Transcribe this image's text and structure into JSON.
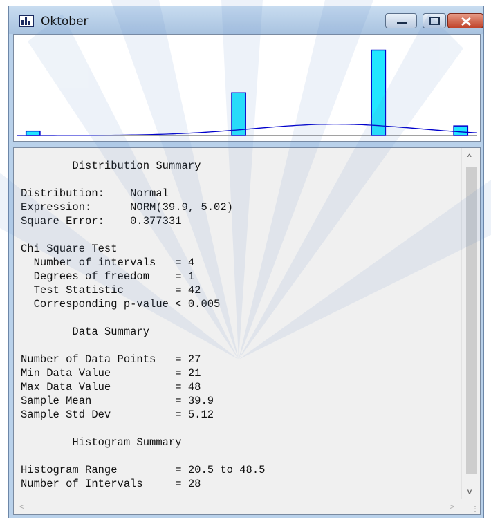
{
  "window": {
    "title": "Oktober",
    "controls": {
      "minimize": "minimize",
      "maximize": "maximize",
      "close": "close"
    }
  },
  "colors": {
    "bar_fill": "#22e6ff",
    "bar_stroke": "#0000cc",
    "curve": "#0000cc",
    "axis": "#444444"
  },
  "chart_data": {
    "type": "bar",
    "x": [
      20.5,
      24.5,
      29.5,
      34.5,
      39.5,
      44.5,
      48.5
    ],
    "x_range": [
      20.5,
      48.5
    ],
    "bars": [
      {
        "x": 21.5,
        "height": 0.05
      },
      {
        "x": 34.0,
        "height": 0.49
      },
      {
        "x": 42.5,
        "height": 0.98
      },
      {
        "x": 47.5,
        "height": 0.11
      }
    ],
    "curve": {
      "name": "",
      "distribution": "NORM(39.9, 5.02)",
      "peak": 0.13
    },
    "title": "",
    "xlabel": "",
    "ylabel": ""
  },
  "report": {
    "lines": [
      "        Distribution Summary",
      "",
      "Distribution:    Normal",
      "Expression:      NORM(39.9, 5.02)",
      "Square Error:    0.377331",
      "",
      "Chi Square Test",
      "  Number of intervals   = 4",
      "  Degrees of freedom    = 1",
      "  Test Statistic        = 42",
      "  Corresponding p-value < 0.005",
      "",
      "        Data Summary",
      "",
      "Number of Data Points   = 27",
      "Min Data Value          = 21",
      "Max Data Value          = 48",
      "Sample Mean             = 39.9",
      "Sample Std Dev          = 5.12",
      "",
      "        Histogram Summary",
      "",
      "Histogram Range         = 20.5 to 48.5",
      "Number of Intervals     = 28"
    ]
  },
  "scrollbars": {
    "up": "^",
    "down": "v",
    "left": "<",
    "right": ">"
  }
}
